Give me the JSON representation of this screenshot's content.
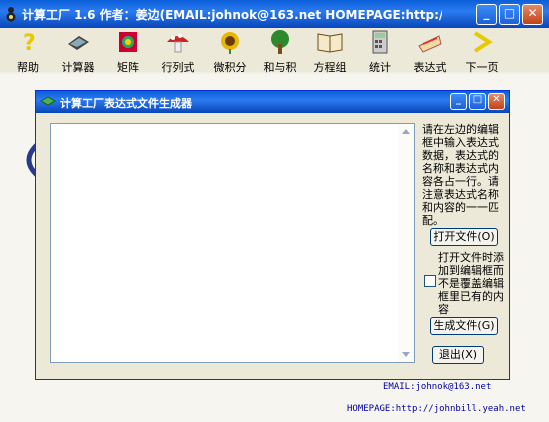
{
  "window": {
    "title": "计算工厂 1.6 作者：姜边(EMAIL:johnok@163.net HOMEPAGE:http://...",
    "caption_buttons": [
      "minimize-icon",
      "maximize-icon",
      "close-icon"
    ]
  },
  "toolbar": {
    "items": [
      {
        "label": "帮助",
        "icon": "help-icon"
      },
      {
        "label": "计算器",
        "icon": "calculator-icon"
      },
      {
        "label": "矩阵",
        "icon": "matrix-icon"
      },
      {
        "label": "行列式",
        "icon": "determinant-icon"
      },
      {
        "label": "微积分",
        "icon": "calculus-icon"
      },
      {
        "label": "和与积",
        "icon": "sum-product-icon"
      },
      {
        "label": "方程组",
        "icon": "equations-icon"
      },
      {
        "label": "统计",
        "icon": "statistics-icon"
      },
      {
        "label": "表达式",
        "icon": "expression-icon"
      },
      {
        "label": "下一页",
        "icon": "next-page-icon"
      }
    ]
  },
  "dialog": {
    "title": "计算工厂表达式文件生成器",
    "editor_value": "",
    "instructions": "请在左边的编辑框中输入表达式数据，表达式的名称和表达式内容各占一行。请注意表达式名称和内容的一一匹配。",
    "open_button": "打开文件(O)",
    "checkbox_label": "打开文件时添加到编辑框而不是覆盖编辑框里已有的内容",
    "checkbox_checked": false,
    "generate_button": "生成文件(G)",
    "exit_button": "退出(X)"
  },
  "footer": {
    "email": "EMAIL:johnok@163.net",
    "homepage": "HOMEPAGE:http://johnbill.yeah.net"
  },
  "colors": {
    "titlebar": "#0a5fd8",
    "face": "#ece9d8",
    "link": "#0000a0"
  }
}
